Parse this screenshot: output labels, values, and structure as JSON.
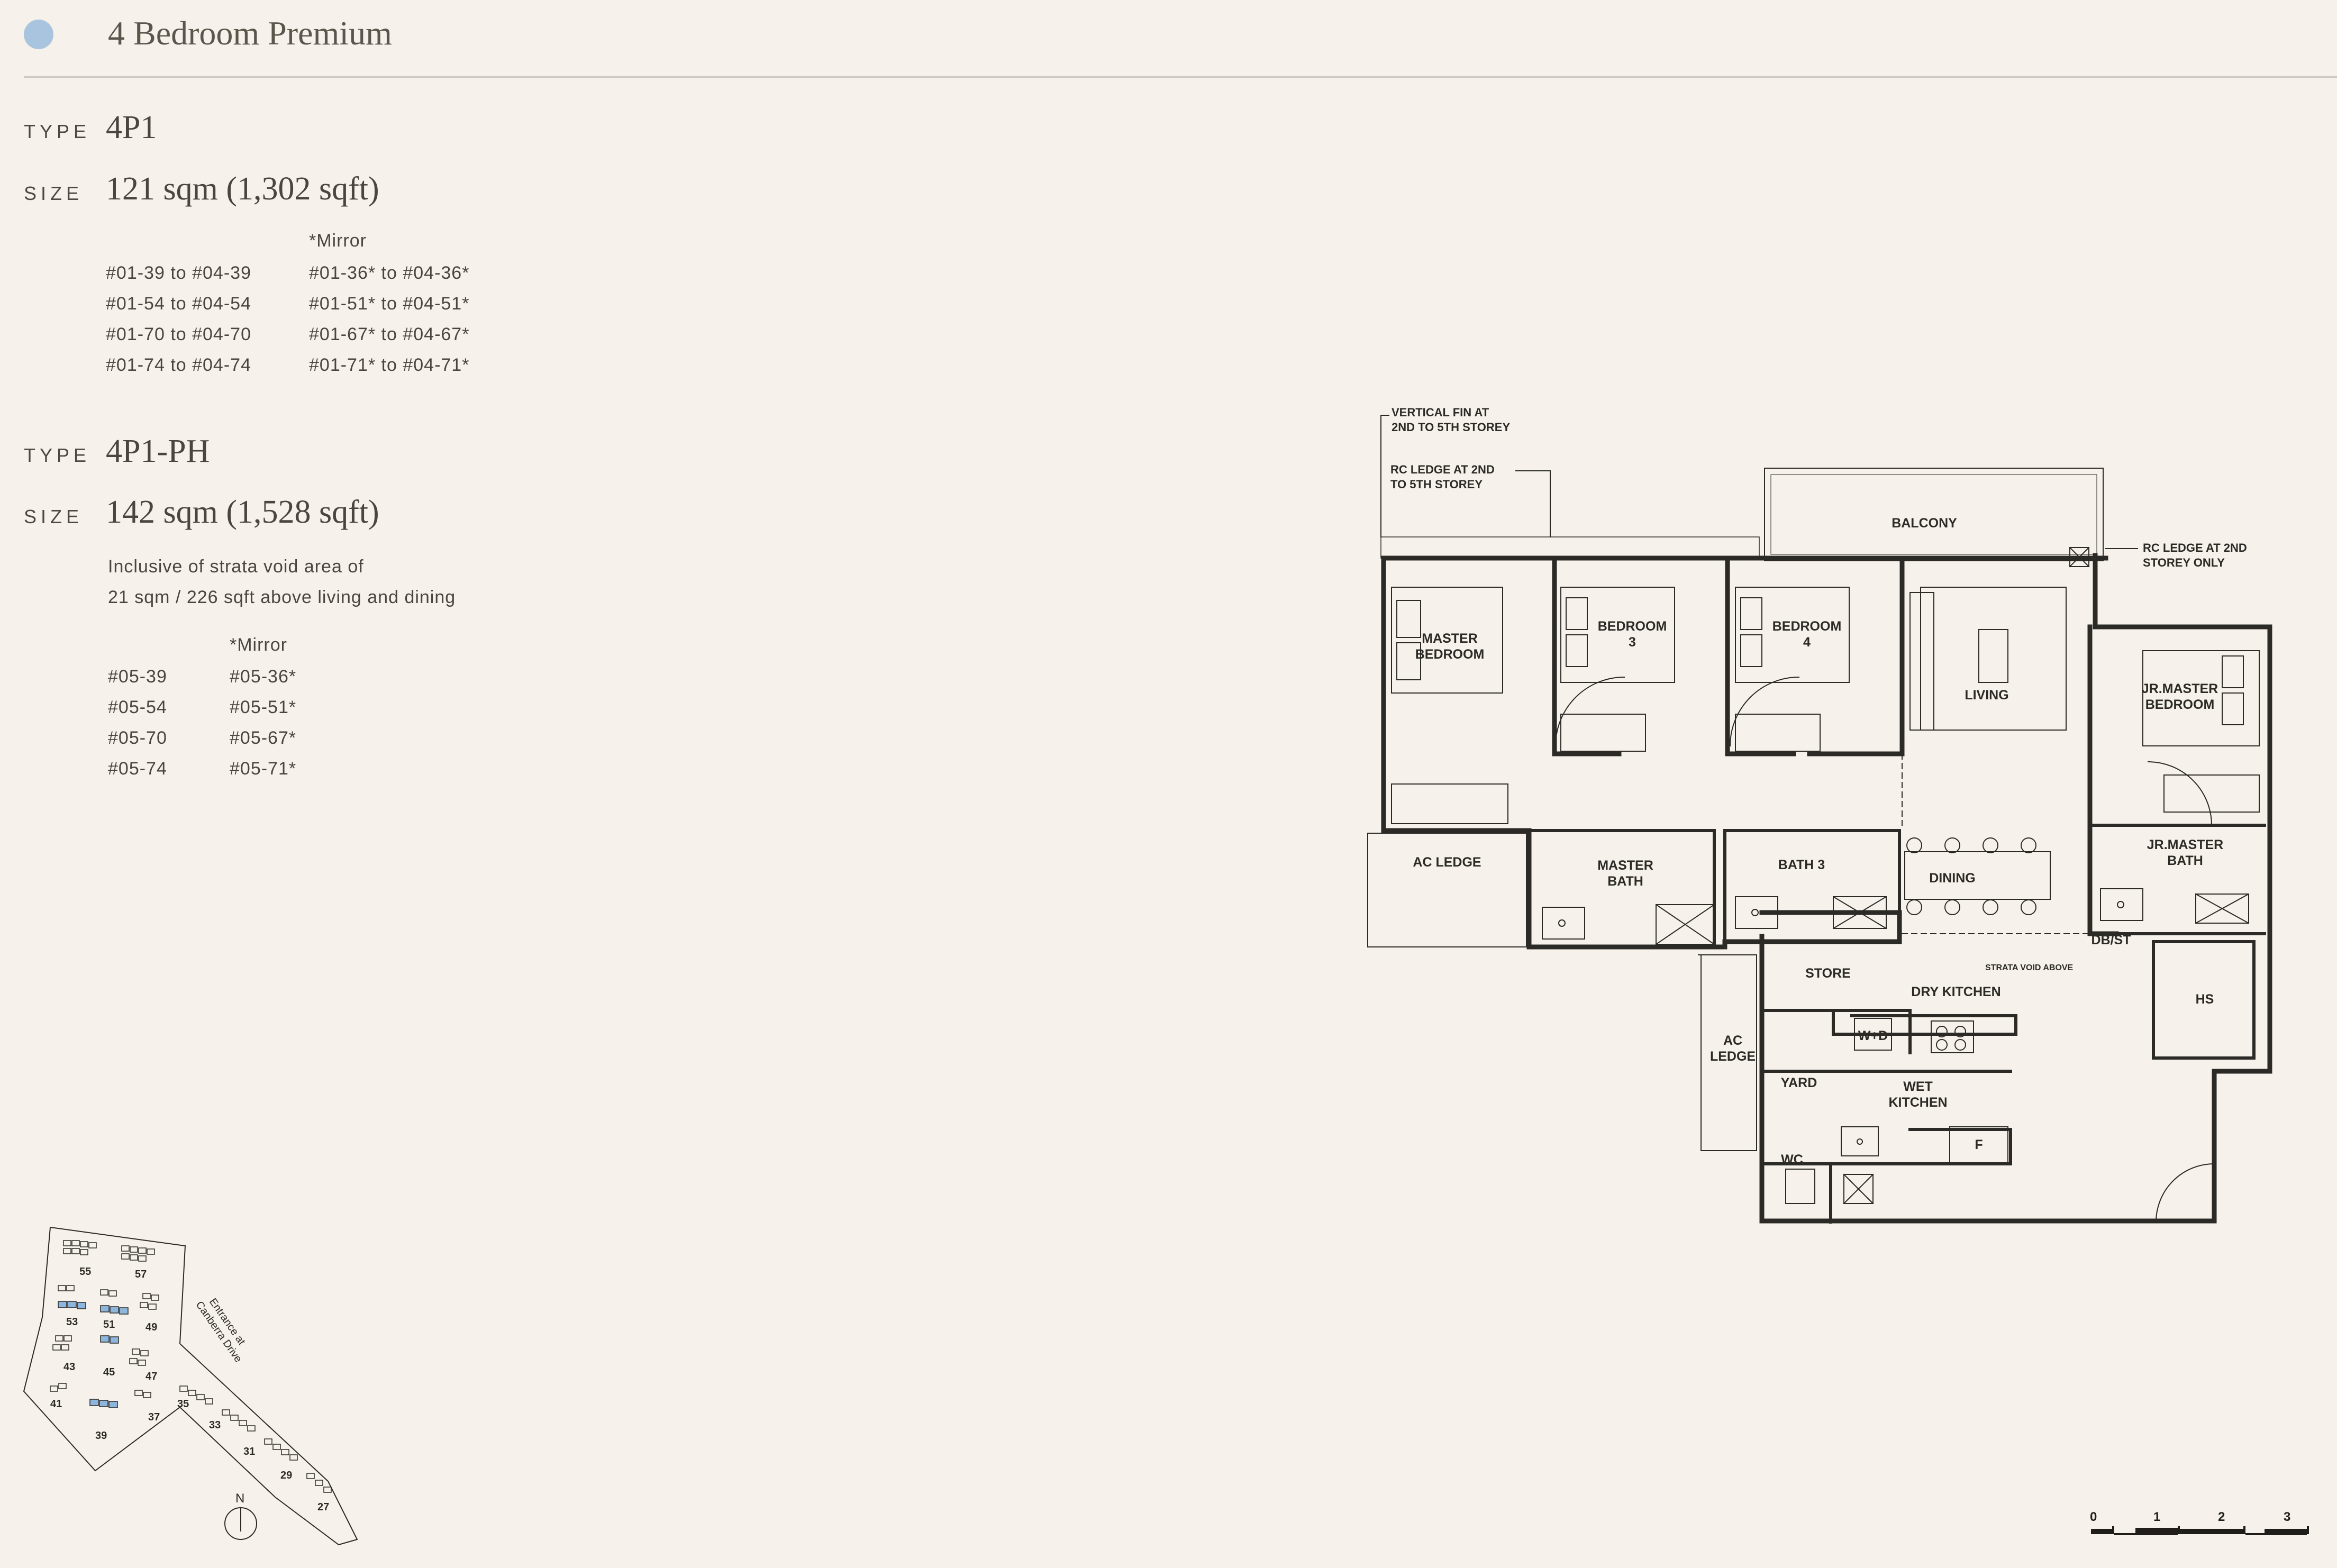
{
  "header": {
    "title": "4 Bedroom Premium"
  },
  "colors": {
    "accent_dot": "#a9c4df",
    "background": "#f6f1ea",
    "highlight_block": "#8eb5dc"
  },
  "type_4p1": {
    "type_label": "TYPE",
    "type_value": "4P1",
    "size_label": "SIZE",
    "size_value": "121 sqm (1,302 sqft)",
    "mirror_heading": "*Mirror",
    "units": [
      "#01-39 to #04-39",
      "#01-54 to #04-54",
      "#01-70 to #04-70",
      "#01-74 to #04-74"
    ],
    "mirror_units": [
      "#01-36* to #04-36*",
      "#01-51* to #04-51*",
      "#01-67* to #04-67*",
      "#01-71* to #04-71*"
    ]
  },
  "type_4p1_ph": {
    "type_label": "TYPE",
    "type_value": "4P1-PH",
    "size_label": "SIZE",
    "size_value": "142 sqm (1,528 sqft)",
    "note_line1": "Inclusive of strata void area of",
    "note_line2": "21 sqm / 226 sqft above living and dining",
    "mirror_heading": "*Mirror",
    "units": [
      "#05-39",
      "#05-54",
      "#05-70",
      "#05-74"
    ],
    "mirror_units": [
      "#05-36*",
      "#05-51*",
      "#05-67*",
      "#05-71*"
    ]
  },
  "floor_plan": {
    "callouts": {
      "vertical_fin_1": "VERTICAL FIN AT",
      "vertical_fin_2": "2ND TO 5TH STOREY",
      "rc_ledge_top_1": "RC LEDGE AT 2ND",
      "rc_ledge_top_2": "TO 5TH STOREY",
      "rc_ledge_right_1": "RC LEDGE AT 2ND",
      "rc_ledge_right_2": "STOREY ONLY",
      "strata_void": "STRATA VOID ABOVE"
    },
    "rooms": {
      "balcony": "BALCONY",
      "master_bedroom_1": "MASTER",
      "master_bedroom_2": "BEDROOM",
      "bedroom3_1": "BEDROOM",
      "bedroom3_2": "3",
      "bedroom4_1": "BEDROOM",
      "bedroom4_2": "4",
      "living": "LIVING",
      "jr_master_bedroom_1": "JR.MASTER",
      "jr_master_bedroom_2": "BEDROOM",
      "ac_ledge": "AC LEDGE",
      "master_bath_1": "MASTER",
      "master_bath_2": "BATH",
      "bath3": "BATH 3",
      "dining": "DINING",
      "jr_master_bath_1": "JR.MASTER",
      "jr_master_bath_2": "BATH",
      "db_st": "DB/ST",
      "store": "STORE",
      "dry_kitchen": "DRY KITCHEN",
      "hs": "HS",
      "ac_ledge_2_1": "AC",
      "ac_ledge_2_2": "LEDGE",
      "wd": "W+D",
      "yard": "YARD",
      "wet_kitchen_1": "WET",
      "wet_kitchen_2": "KITCHEN",
      "fridge": "F",
      "wc": "WC"
    }
  },
  "site_plan": {
    "entrance_1": "Entrance at",
    "entrance_2": "Canberra Drive",
    "north": "N",
    "blocks": [
      "55",
      "57",
      "53",
      "51",
      "49",
      "43",
      "45",
      "47",
      "41",
      "39",
      "37",
      "35",
      "33",
      "31",
      "29",
      "27"
    ]
  },
  "scale": {
    "ticks": [
      "0",
      "1",
      "2",
      "3"
    ]
  }
}
